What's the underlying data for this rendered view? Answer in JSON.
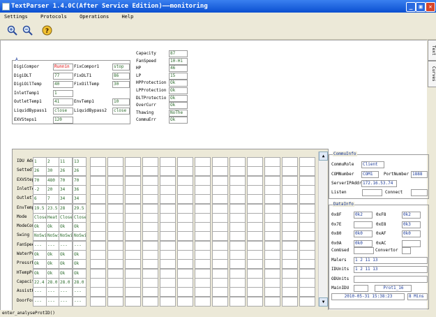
{
  "window": {
    "title": "TextParser 1.4.0C(After Service Edition)——monitoring"
  },
  "menu": [
    "Settings",
    "Protocols",
    "Operations",
    "Help"
  ],
  "toolbar": {
    "zoom_in": "zoom-in-icon",
    "zoom_out": "zoom-out-icon",
    "help": "help-icon"
  },
  "right_tabs": [
    "Text",
    "Curves"
  ],
  "topleft": {
    "group_label": "A",
    "rows": [
      {
        "l1": "DigiCompor",
        "v1": "Runnin",
        "l2": "FixCompor1",
        "v2": "stop"
      },
      {
        "l1": "DigiDLT",
        "v1": "77",
        "l2": "FixDLT1",
        "v2": "86"
      },
      {
        "l1": "DigiOilTemp",
        "v1": "40",
        "l2": "FixOilTemp",
        "v2": "30"
      },
      {
        "l1": "InletTemp1",
        "v1": "1",
        "l2": "",
        "v2": ""
      },
      {
        "l1": "OutletTemp1",
        "v1": "41",
        "l2": "EnvTemp1",
        "v2": "10"
      },
      {
        "l1": "LiquidBypass1",
        "v1": "close",
        "l2": "LiquidBypass2",
        "v2": "close"
      },
      {
        "l1": "EXVSteps1",
        "v1": "120",
        "l2": "",
        "v2": ""
      }
    ]
  },
  "params": [
    {
      "label": "Capacity",
      "value": "87"
    },
    {
      "label": "FanSpeed",
      "value": "10-Hi"
    },
    {
      "label": "HP",
      "value": "46"
    },
    {
      "label": "LP",
      "value": "15"
    },
    {
      "label": "HPProtection",
      "value": "Ok"
    },
    {
      "label": "LPProtection",
      "value": "Ok"
    },
    {
      "label": "DLTProtectio",
      "value": "Ok"
    },
    {
      "label": "OverCurr",
      "value": "Ok"
    },
    {
      "label": "Thawing",
      "value": "NoThe"
    },
    {
      "label": "CommuErr",
      "value": "Ok"
    }
  ],
  "grid": {
    "rows": [
      {
        "label": "IDU Addr",
        "values": [
          "1",
          "2",
          "11",
          "13"
        ]
      },
      {
        "label": "SettedTe",
        "values": [
          "26",
          "30",
          "26",
          "26"
        ]
      },
      {
        "label": "EXVSteps",
        "values": [
          "70",
          "480",
          "70",
          "70"
        ]
      },
      {
        "label": "InletTem",
        "values": [
          "-2",
          "20",
          "34",
          "36"
        ]
      },
      {
        "label": "OutletTe",
        "values": [
          "6",
          "7",
          "34",
          "34"
        ]
      },
      {
        "label": "EnvTemp",
        "values": [
          "19.5",
          "23.5",
          "28",
          "29.5"
        ]
      },
      {
        "label": "Mode",
        "values": [
          "Close",
          "Heat",
          "Close",
          "Close"
        ]
      },
      {
        "label": "ModeComp",
        "values": [
          "Ok",
          "Ok",
          "Ok",
          "Ok"
        ]
      },
      {
        "label": "Swing",
        "values": [
          "NoSwi",
          "NoSwi",
          "NoSwi",
          "NoSwi"
        ]
      },
      {
        "label": "FanSpeed",
        "values": [
          "---",
          "---",
          "---",
          "---"
        ]
      },
      {
        "label": "WaterPul",
        "values": [
          "Ok",
          "Ok",
          "Ok",
          "Ok"
        ]
      },
      {
        "label": "PressrPr",
        "values": [
          "Ok",
          "Ok",
          "Ok",
          "Ok"
        ]
      },
      {
        "label": "HTempPro",
        "values": [
          "Ok",
          "Ok",
          "Ok",
          "Ok"
        ]
      },
      {
        "label": "Capacity",
        "values": [
          "22.4",
          "28.0",
          "28.0",
          "28.0"
        ]
      },
      {
        "label": "AssistHe",
        "values": [
          "---",
          "---",
          "---",
          "---"
        ]
      },
      {
        "label": "DoorForb",
        "values": [
          "---",
          "---",
          "---",
          "---"
        ]
      }
    ]
  },
  "commu": {
    "title": "CommuInfo",
    "role_label": "CommuRole",
    "role_value": "Client",
    "com_label": "COMNumber",
    "com_value": "COM1",
    "port_label": "PortNumber",
    "port_value": "1888",
    "ip_label": "ServerIPAddr",
    "ip_value": "172.16.53.74",
    "listen_label": "Listen",
    "connect_label": "Connect"
  },
  "datainfo": {
    "title": "DataInfo",
    "pairs": [
      {
        "l1": "0x8F",
        "v1": "0k2",
        "l2": "0xF8",
        "v2": "0k2"
      },
      {
        "l1": "0x7E",
        "v1": "",
        "l2": "0xE8",
        "v2": "0k3"
      },
      {
        "l1": "0x80",
        "v1": "0k0",
        "l2": "0xAF",
        "v2": "0k0"
      },
      {
        "l1": "0x0A",
        "v1": "0k0",
        "l2": "0xAC",
        "v2": ""
      }
    ],
    "comused_label": "ComUsed",
    "convertor_label": "Convertor",
    "malers_label": "Malers",
    "malers_value": "1 2 11 13",
    "idunits_label": "IDUnits",
    "idunits_value": "1 2 11 13",
    "odunits_label": "ODUnits",
    "mainidu_label": "MainIDU",
    "prot_value": "Prot1_16",
    "datetime": "2010-05-31 15:38:23",
    "mins": "8 Mins"
  },
  "status": "enter_analyseProtID()"
}
